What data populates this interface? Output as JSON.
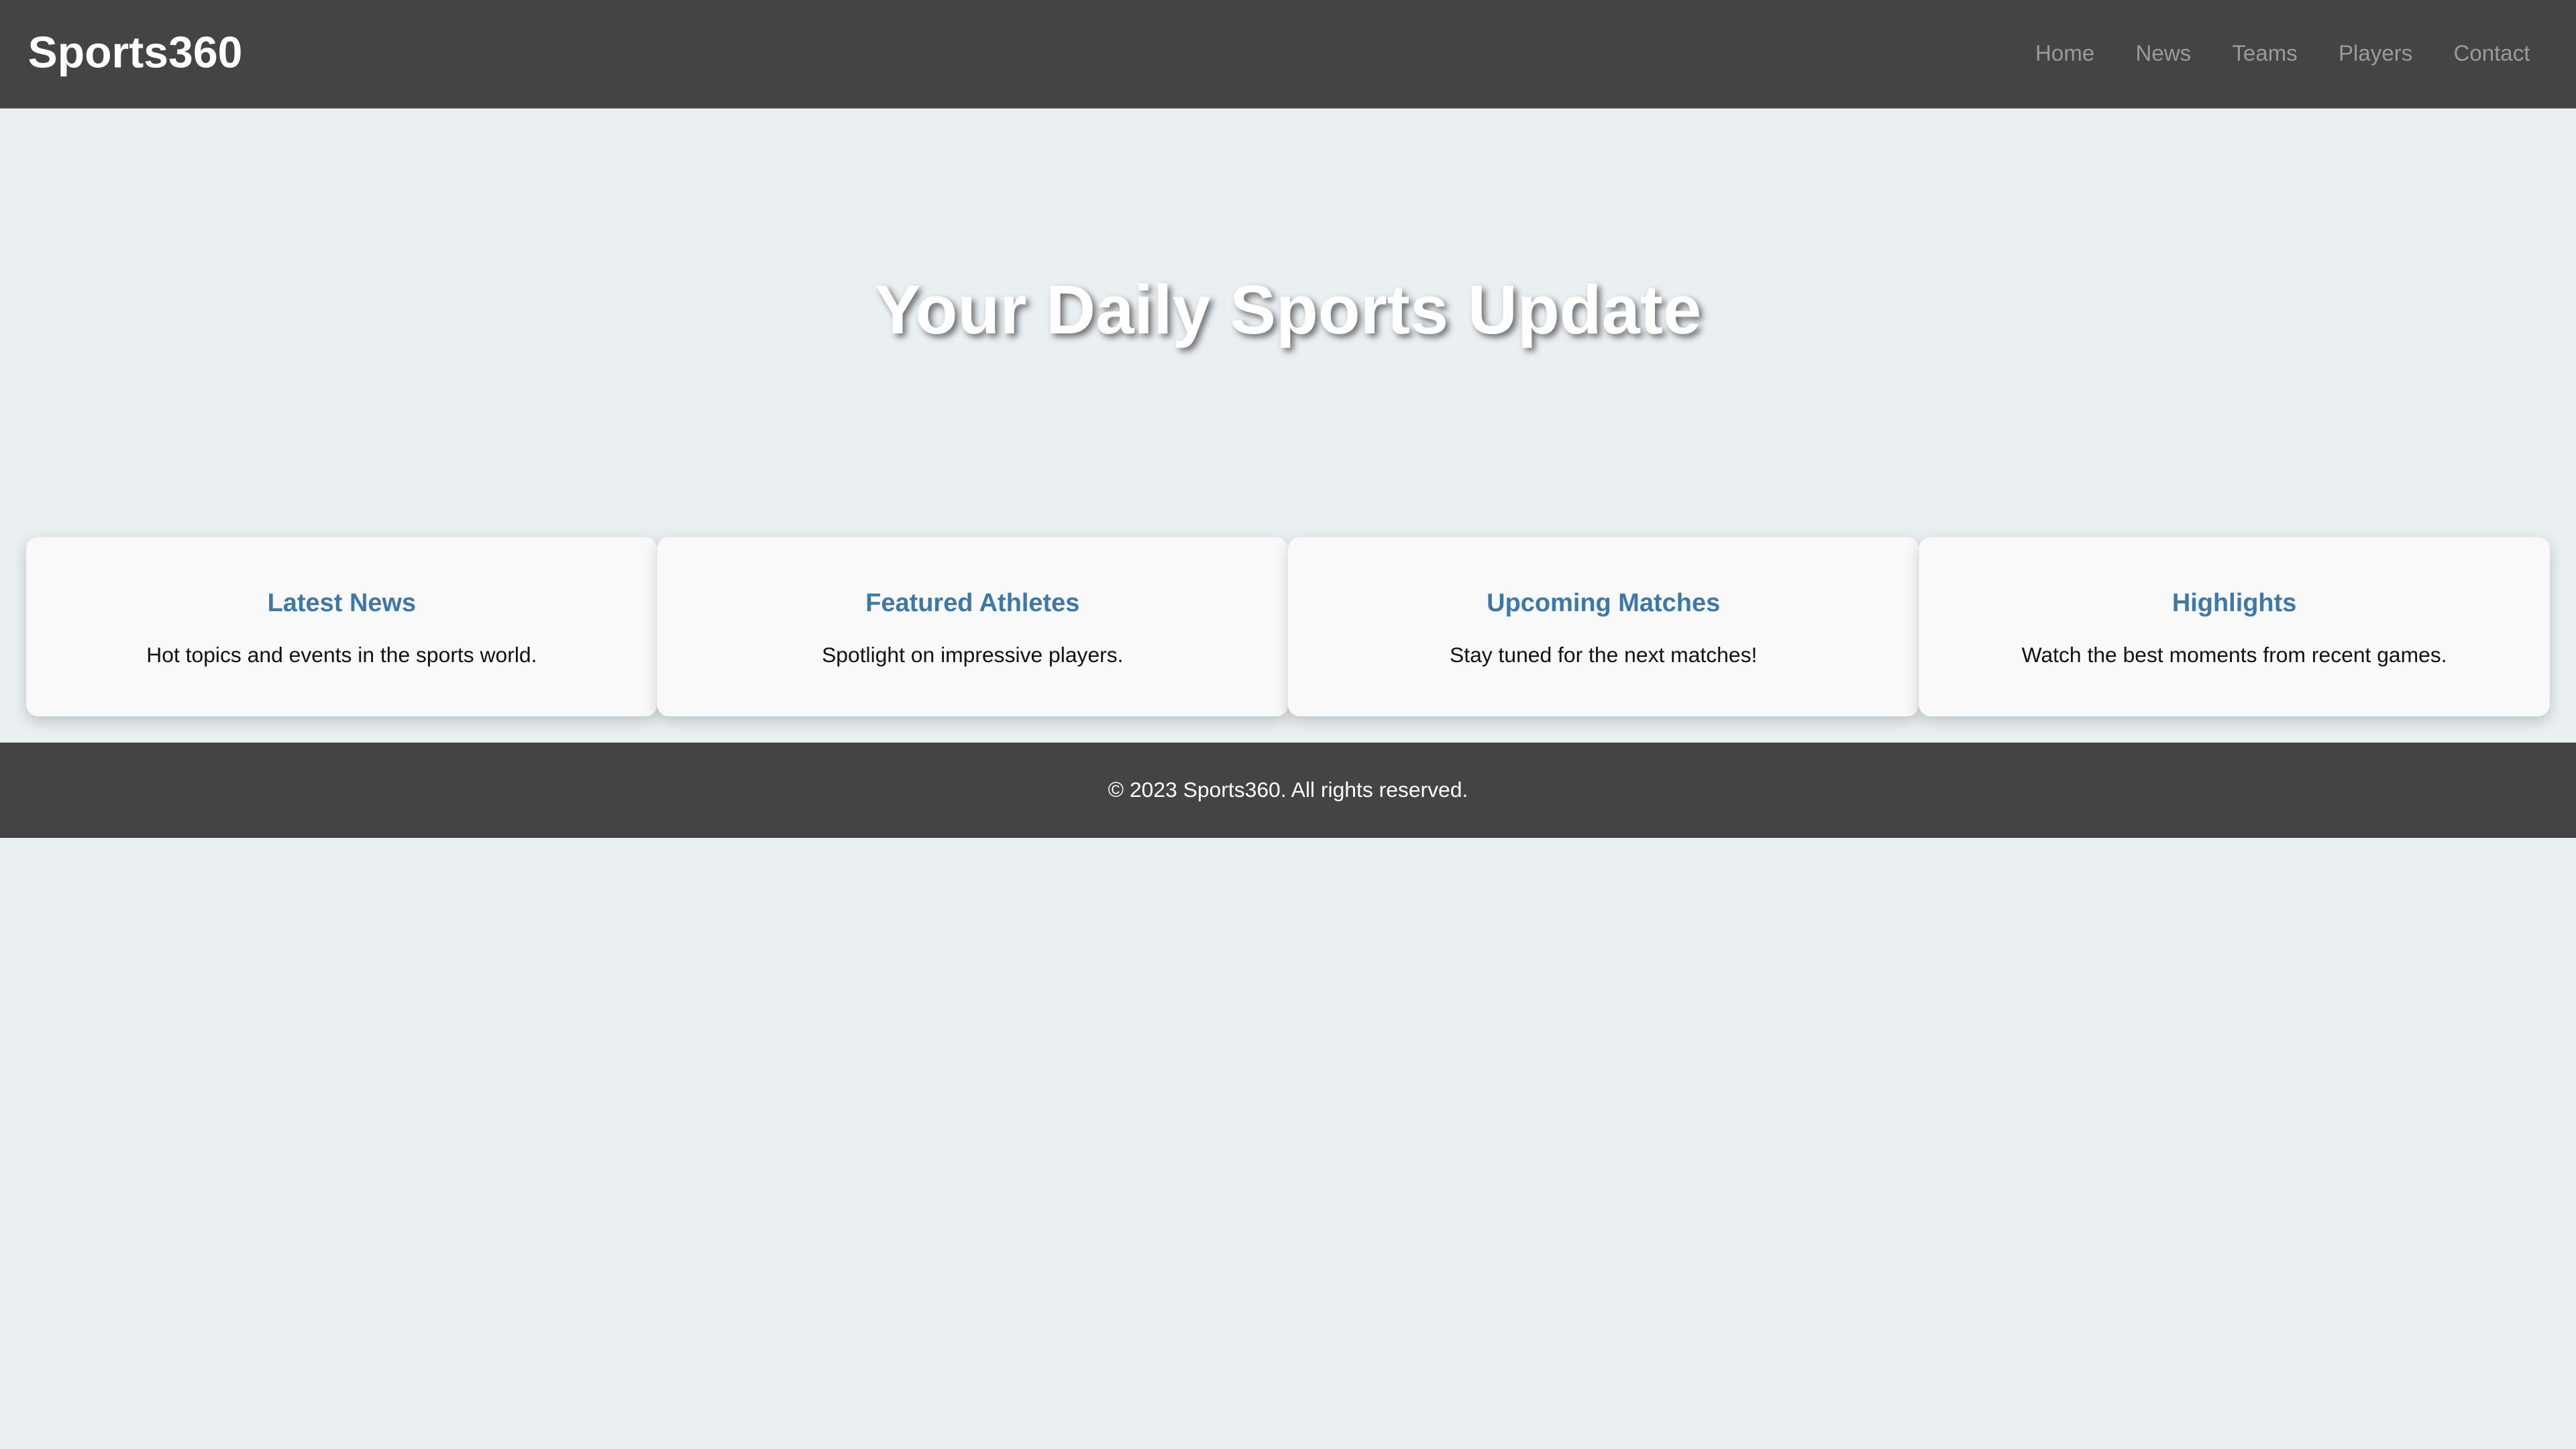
{
  "header": {
    "brand": "Sports360",
    "nav": [
      "Home",
      "News",
      "Teams",
      "Players",
      "Contact"
    ]
  },
  "hero": {
    "title": "Your Daily Sports Update"
  },
  "cards": [
    {
      "title": "Latest News",
      "text": "Hot topics and events in the sports world."
    },
    {
      "title": "Featured Athletes",
      "text": "Spotlight on impressive players."
    },
    {
      "title": "Upcoming Matches",
      "text": "Stay tuned for the next matches!"
    },
    {
      "title": "Highlights",
      "text": "Watch the best moments from recent games."
    }
  ],
  "footer": {
    "text": "© 2023 Sports360. All rights reserved."
  },
  "colors": {
    "background": "#eaeff2",
    "bar": "#444444",
    "accent": "#3c78a8",
    "nav_link": "#9a9a9a"
  }
}
